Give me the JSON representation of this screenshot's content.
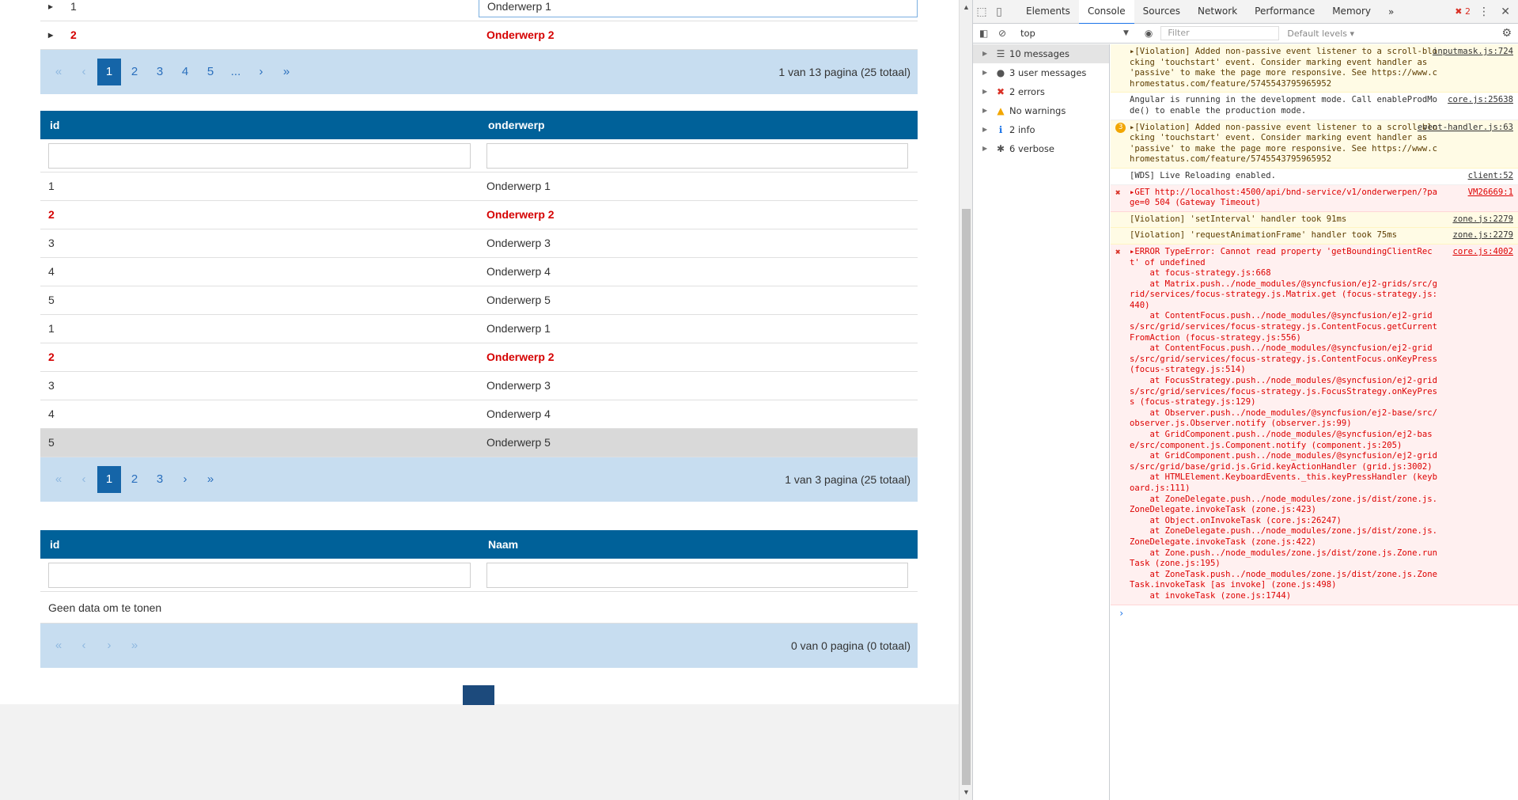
{
  "grid1": {
    "rows": [
      {
        "id": "1",
        "subject": "Onderwerp 1",
        "highlight": false
      },
      {
        "id": "2",
        "subject": "Onderwerp 2",
        "highlight": true
      }
    ],
    "pager": {
      "pages": [
        "1",
        "2",
        "3",
        "4",
        "5",
        "..."
      ],
      "current": "1",
      "info": "1 van 13 pagina (25 totaal)"
    }
  },
  "grid2": {
    "columns": [
      "id",
      "onderwerp"
    ],
    "rows": [
      {
        "id": "1",
        "subject": "Onderwerp 1",
        "highlight": false
      },
      {
        "id": "2",
        "subject": "Onderwerp 2",
        "highlight": true
      },
      {
        "id": "3",
        "subject": "Onderwerp 3",
        "highlight": false
      },
      {
        "id": "4",
        "subject": "Onderwerp 4",
        "highlight": false
      },
      {
        "id": "5",
        "subject": "Onderwerp 5",
        "highlight": false
      },
      {
        "id": "1",
        "subject": "Onderwerp 1",
        "highlight": false
      },
      {
        "id": "2",
        "subject": "Onderwerp 2",
        "highlight": true
      },
      {
        "id": "3",
        "subject": "Onderwerp 3",
        "highlight": false
      },
      {
        "id": "4",
        "subject": "Onderwerp 4",
        "highlight": false
      },
      {
        "id": "5",
        "subject": "Onderwerp 5",
        "highlight": false,
        "selected": true
      }
    ],
    "pager": {
      "pages": [
        "1",
        "2",
        "3"
      ],
      "current": "1",
      "info": "1 van 3 pagina (25 totaal)"
    }
  },
  "grid3": {
    "columns": [
      "id",
      "Naam"
    ],
    "empty_text": "Geen data om te tonen",
    "pager": {
      "info": "0 van 0 pagina (0 totaal)"
    }
  },
  "pager_nav": {
    "first": "«",
    "prev": "‹",
    "next": "›",
    "last": "»"
  },
  "devtools": {
    "tabs": [
      "Elements",
      "Console",
      "Sources",
      "Network",
      "Performance",
      "Memory"
    ],
    "active_tab": "Console",
    "more": "»",
    "error_count": "2",
    "context": "top",
    "filter_placeholder": "Filter",
    "levels": "Default levels ▾",
    "sidebar": [
      {
        "label": "10 messages",
        "icon": "list-icon",
        "glyph": "☰",
        "color": "#555"
      },
      {
        "label": "3 user messages",
        "icon": "user-icon",
        "glyph": "●",
        "color": "#555"
      },
      {
        "label": "2 errors",
        "icon": "error-icon",
        "glyph": "✖",
        "color": "#d93025"
      },
      {
        "label": "No warnings",
        "icon": "warning-icon",
        "glyph": "▲",
        "color": "#f2a600"
      },
      {
        "label": "2 info",
        "icon": "info-icon",
        "glyph": "ℹ",
        "color": "#1a73e8"
      },
      {
        "label": "6 verbose",
        "icon": "bug-icon",
        "glyph": "✱",
        "color": "#555"
      }
    ],
    "messages": [
      {
        "level": "warn",
        "text": "▸[Violation] Added non-passive event listener to a scroll-blocking 'touchstart' event. Consider marking event handler as 'passive' to make the page more responsive. See https://www.chromestatus.com/feature/5745543795965952",
        "source": "inputmask.js:724"
      },
      {
        "level": "info",
        "text": "Angular is running in the development mode. Call enableProdMode() to enable the production mode.",
        "source": "core.js:25638"
      },
      {
        "level": "warn",
        "badge": "3",
        "text": "▸[Violation] Added non-passive event listener to a scroll-blocking 'touchstart' event. Consider marking event handler as 'passive' to make the page more responsive. See https://www.chromestatus.com/feature/5745543795965952",
        "source": "event-handler.js:63"
      },
      {
        "level": "info",
        "text": "[WDS] Live Reloading enabled.",
        "source": "client:52"
      },
      {
        "level": "err",
        "text": "▸GET http://localhost:4500/api/bnd-service/v1/onderwerpen/?page=0 504 (Gateway Timeout)",
        "source": "VM26669:1"
      },
      {
        "level": "warn",
        "text": "[Violation] 'setInterval' handler took 91ms",
        "source": "zone.js:2279"
      },
      {
        "level": "warn",
        "text": "[Violation] 'requestAnimationFrame' handler took 75ms",
        "source": "zone.js:2279"
      },
      {
        "level": "err",
        "text": "▸ERROR TypeError: Cannot read property 'getBoundingClientRect' of undefined\n    at focus-strategy.js:668\n    at Matrix.push../node_modules/@syncfusion/ej2-grids/src/grid/services/focus-strategy.js.Matrix.get (focus-strategy.js:440)\n    at ContentFocus.push../node_modules/@syncfusion/ej2-grids/src/grid/services/focus-strategy.js.ContentFocus.getCurrentFromAction (focus-strategy.js:556)\n    at ContentFocus.push../node_modules/@syncfusion/ej2-grids/src/grid/services/focus-strategy.js.ContentFocus.onKeyPress (focus-strategy.js:514)\n    at FocusStrategy.push../node_modules/@syncfusion/ej2-grids/src/grid/services/focus-strategy.js.FocusStrategy.onKeyPress (focus-strategy.js:129)\n    at Observer.push../node_modules/@syncfusion/ej2-base/src/observer.js.Observer.notify (observer.js:99)\n    at GridComponent.push../node_modules/@syncfusion/ej2-base/src/component.js.Component.notify (component.js:205)\n    at GridComponent.push../node_modules/@syncfusion/ej2-grids/src/grid/base/grid.js.Grid.keyActionHandler (grid.js:3002)\n    at HTMLElement.KeyboardEvents._this.keyPressHandler (keyboard.js:111)\n    at ZoneDelegate.push../node_modules/zone.js/dist/zone.js.ZoneDelegate.invokeTask (zone.js:423)\n    at Object.onInvokeTask (core.js:26247)\n    at ZoneDelegate.push../node_modules/zone.js/dist/zone.js.ZoneDelegate.invokeTask (zone.js:422)\n    at Zone.push../node_modules/zone.js/dist/zone.js.Zone.runTask (zone.js:195)\n    at ZoneTask.push../node_modules/zone.js/dist/zone.js.ZoneTask.invokeTask [as invoke] (zone.js:498)\n    at invokeTask (zone.js:1744)",
        "source": "core.js:4002"
      }
    ],
    "prompt": "›"
  }
}
